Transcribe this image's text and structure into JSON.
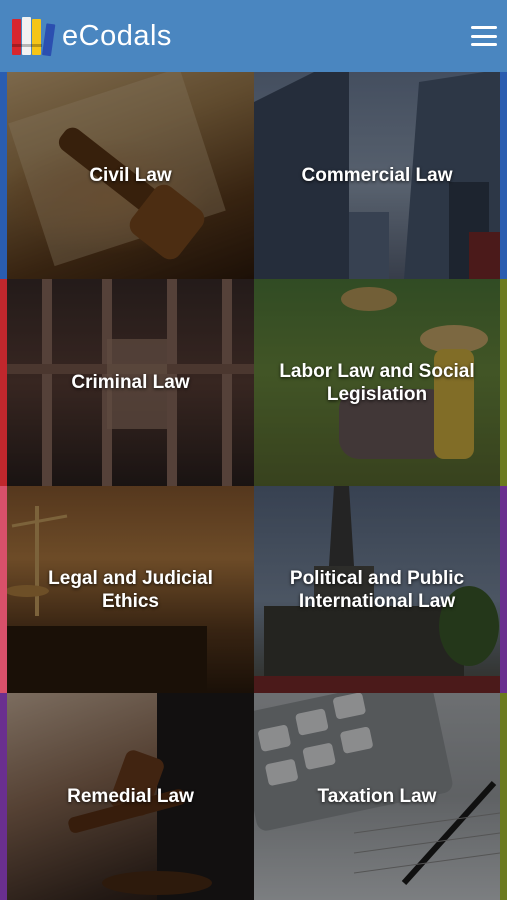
{
  "app": {
    "title": "eCodals"
  },
  "colors": {
    "header": "#4a86c0",
    "edge_blue": "#2a5db0",
    "edge_red": "#c0272d",
    "edge_pink": "#d8506a",
    "edge_purple": "#6a2f8f",
    "edge_olive": "#6b7a1f"
  },
  "tiles": [
    {
      "label": "Civil Law",
      "icon": "gavel-contract-photo"
    },
    {
      "label": "Commercial Law",
      "icon": "skyscrapers-photo"
    },
    {
      "label": "Criminal Law",
      "icon": "jail-bars-photo"
    },
    {
      "label": "Labor Law and Social Legislation",
      "icon": "farm-workers-photo"
    },
    {
      "label": "Legal and Judicial Ethics",
      "icon": "scales-of-justice-photo"
    },
    {
      "label": "Political and Public International Law",
      "icon": "monument-photo"
    },
    {
      "label": "Remedial Law",
      "icon": "judge-gavel-photo"
    },
    {
      "label": "Taxation Law",
      "icon": "calculator-pen-photo"
    }
  ]
}
